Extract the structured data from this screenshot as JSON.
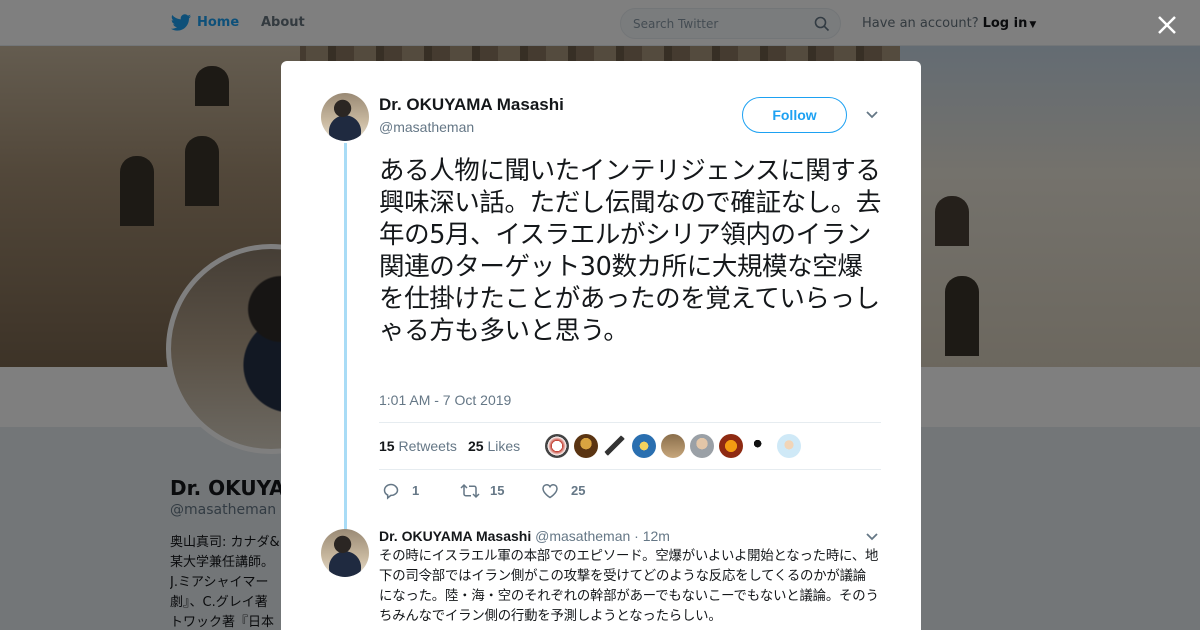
{
  "nav": {
    "home_label": "Home",
    "about_label": "About",
    "search_placeholder": "Search Twitter",
    "account_prompt": "Have an account?",
    "login_label": "Log in"
  },
  "profile": {
    "name": "Dr. OKUYAMA Masashi",
    "name_visible": "Dr. OKUYAM",
    "handle": "@masatheman",
    "bio_lines": [
      "奥山真司: カナダ&",
      "某大学兼任講師。",
      "J.ミアシャイマー",
      "劇』、C.グレイ著",
      "トワック著『日本"
    ]
  },
  "tweet": {
    "author_name": "Dr. OKUYAMA Masashi",
    "author_handle": "@masatheman",
    "follow_label": "Follow",
    "text": "ある人物に聞いたインテリジェンスに関する興味深い話。ただし伝聞なので確証なし。去年の5月、イスラエルがシリア領内のイラン関連のターゲット30数カ所に大規模な空爆を仕掛けたことがあったのを覚えていらっしゃる方も多いと思う。",
    "timestamp": "1:01 AM - 7 Oct 2019",
    "retweets_count": "15",
    "retweets_label": "Retweets",
    "likes_count": "25",
    "likes_label": "Likes",
    "reply_count": "1",
    "retweet_action_count": "15",
    "like_action_count": "25"
  },
  "reply": {
    "author_name": "Dr. OKUYAMA Masashi",
    "author_handle": "@masatheman",
    "time": "· 12m",
    "text": "その時にイスラエル軍の本部でのエピソード。空爆がいよいよ開始となった時に、地下の司令部ではイラン側がこの攻撃を受けてどのような反応をしてくるのかが議論になった。陸・海・空のそれぞれの幹部があーでもないこーでもないと議論。そのうちみんなでイラン側の行動を予測しようとなったらしい。"
  },
  "colors": {
    "accent": "#1da1f2",
    "thread_line": "#a9dcf6",
    "muted_text": "#657786"
  },
  "icons": [
    "twitter-bird-icon",
    "search-icon",
    "close-icon",
    "chevron-down-icon",
    "reply-icon",
    "retweet-icon",
    "heart-icon"
  ]
}
